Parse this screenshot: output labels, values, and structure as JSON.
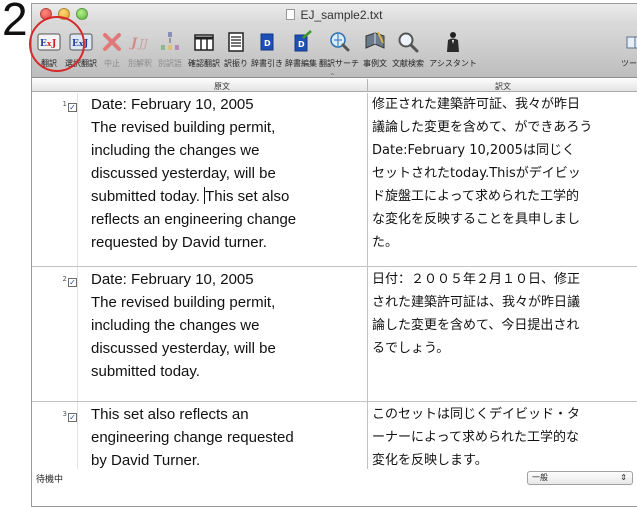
{
  "step_number": "2",
  "window": {
    "title": "EJ_sample2.txt"
  },
  "toolbar": {
    "items": [
      {
        "label": "翻訳",
        "icon": "translate-icon",
        "enabled": true
      },
      {
        "label": "選択翻訳",
        "icon": "selection-translate-icon",
        "enabled": true
      },
      {
        "label": "中止",
        "icon": "stop-icon",
        "enabled": false
      },
      {
        "label": "別解釈",
        "icon": "alternate-interpretation-icon",
        "enabled": false
      },
      {
        "label": "別訳語",
        "icon": "alternate-word-icon",
        "enabled": false
      },
      {
        "label": "確認翻訳",
        "icon": "confirm-translation-icon",
        "enabled": true
      },
      {
        "label": "訳振り",
        "icon": "interlinear-icon",
        "enabled": true
      },
      {
        "label": "辞書引き",
        "icon": "dictionary-lookup-icon",
        "enabled": true
      },
      {
        "label": "辞書編集",
        "icon": "dictionary-edit-icon",
        "enabled": true
      },
      {
        "label": "翻訳サーチ",
        "icon": "translation-search-icon",
        "enabled": true
      },
      {
        "label": "事例文",
        "icon": "example-sentence-icon",
        "enabled": true
      },
      {
        "label": "文献検索",
        "icon": "literature-search-icon",
        "enabled": true
      },
      {
        "label": "アシスタント",
        "icon": "assistant-icon",
        "enabled": true
      },
      {
        "label": "ツール",
        "icon": "tools-icon",
        "enabled": true
      }
    ]
  },
  "columns": {
    "source": "原文",
    "target": "訳文"
  },
  "rows": [
    {
      "number": "1",
      "checked": true,
      "source_lines": [
        "Date: February 10, 2005",
        "The revised building permit,",
        "including the changes we",
        "discussed yesterday, will be",
        "submitted today. ",
        "reflects an engineering change",
        "requested by David turner."
      ],
      "source_caret_tail": "This set also",
      "target_lines": [
        "修正された建築許可証、我々が昨日",
        "議論した変更を含めて、ができあろう",
        "Date:February 10,2005は同じく",
        "セットされたtoday.Thisがデイビッ",
        "ド旋盤工によって求められた工学的",
        "な変化を反映することを具申しまし",
        "た。"
      ]
    },
    {
      "number": "2",
      "checked": true,
      "source_lines": [
        "Date: February 10, 2005",
        "The revised building permit,",
        "including the changes we",
        "discussed yesterday, will be",
        "submitted today."
      ],
      "target_lines": [
        "日付：２００５年２月１０日、修正",
        "された建築許可証は、我々が昨日議",
        "論した変更を含めて、今日提出され",
        "るでしょう。"
      ]
    },
    {
      "number": "3",
      "checked": true,
      "source_lines": [
        "This set also reflects an",
        "engineering change requested",
        "by David Turner."
      ],
      "target_lines": [
        "このセットは同じくデイビッド・タ",
        "ーナーによって求められた工学的な",
        "変化を反映します。"
      ]
    }
  ],
  "status": {
    "text": "待機中",
    "mode": "一般"
  },
  "colors": {
    "highlight_ring": "#d62a2a",
    "checkbox_mark": "#1d4fb5"
  }
}
